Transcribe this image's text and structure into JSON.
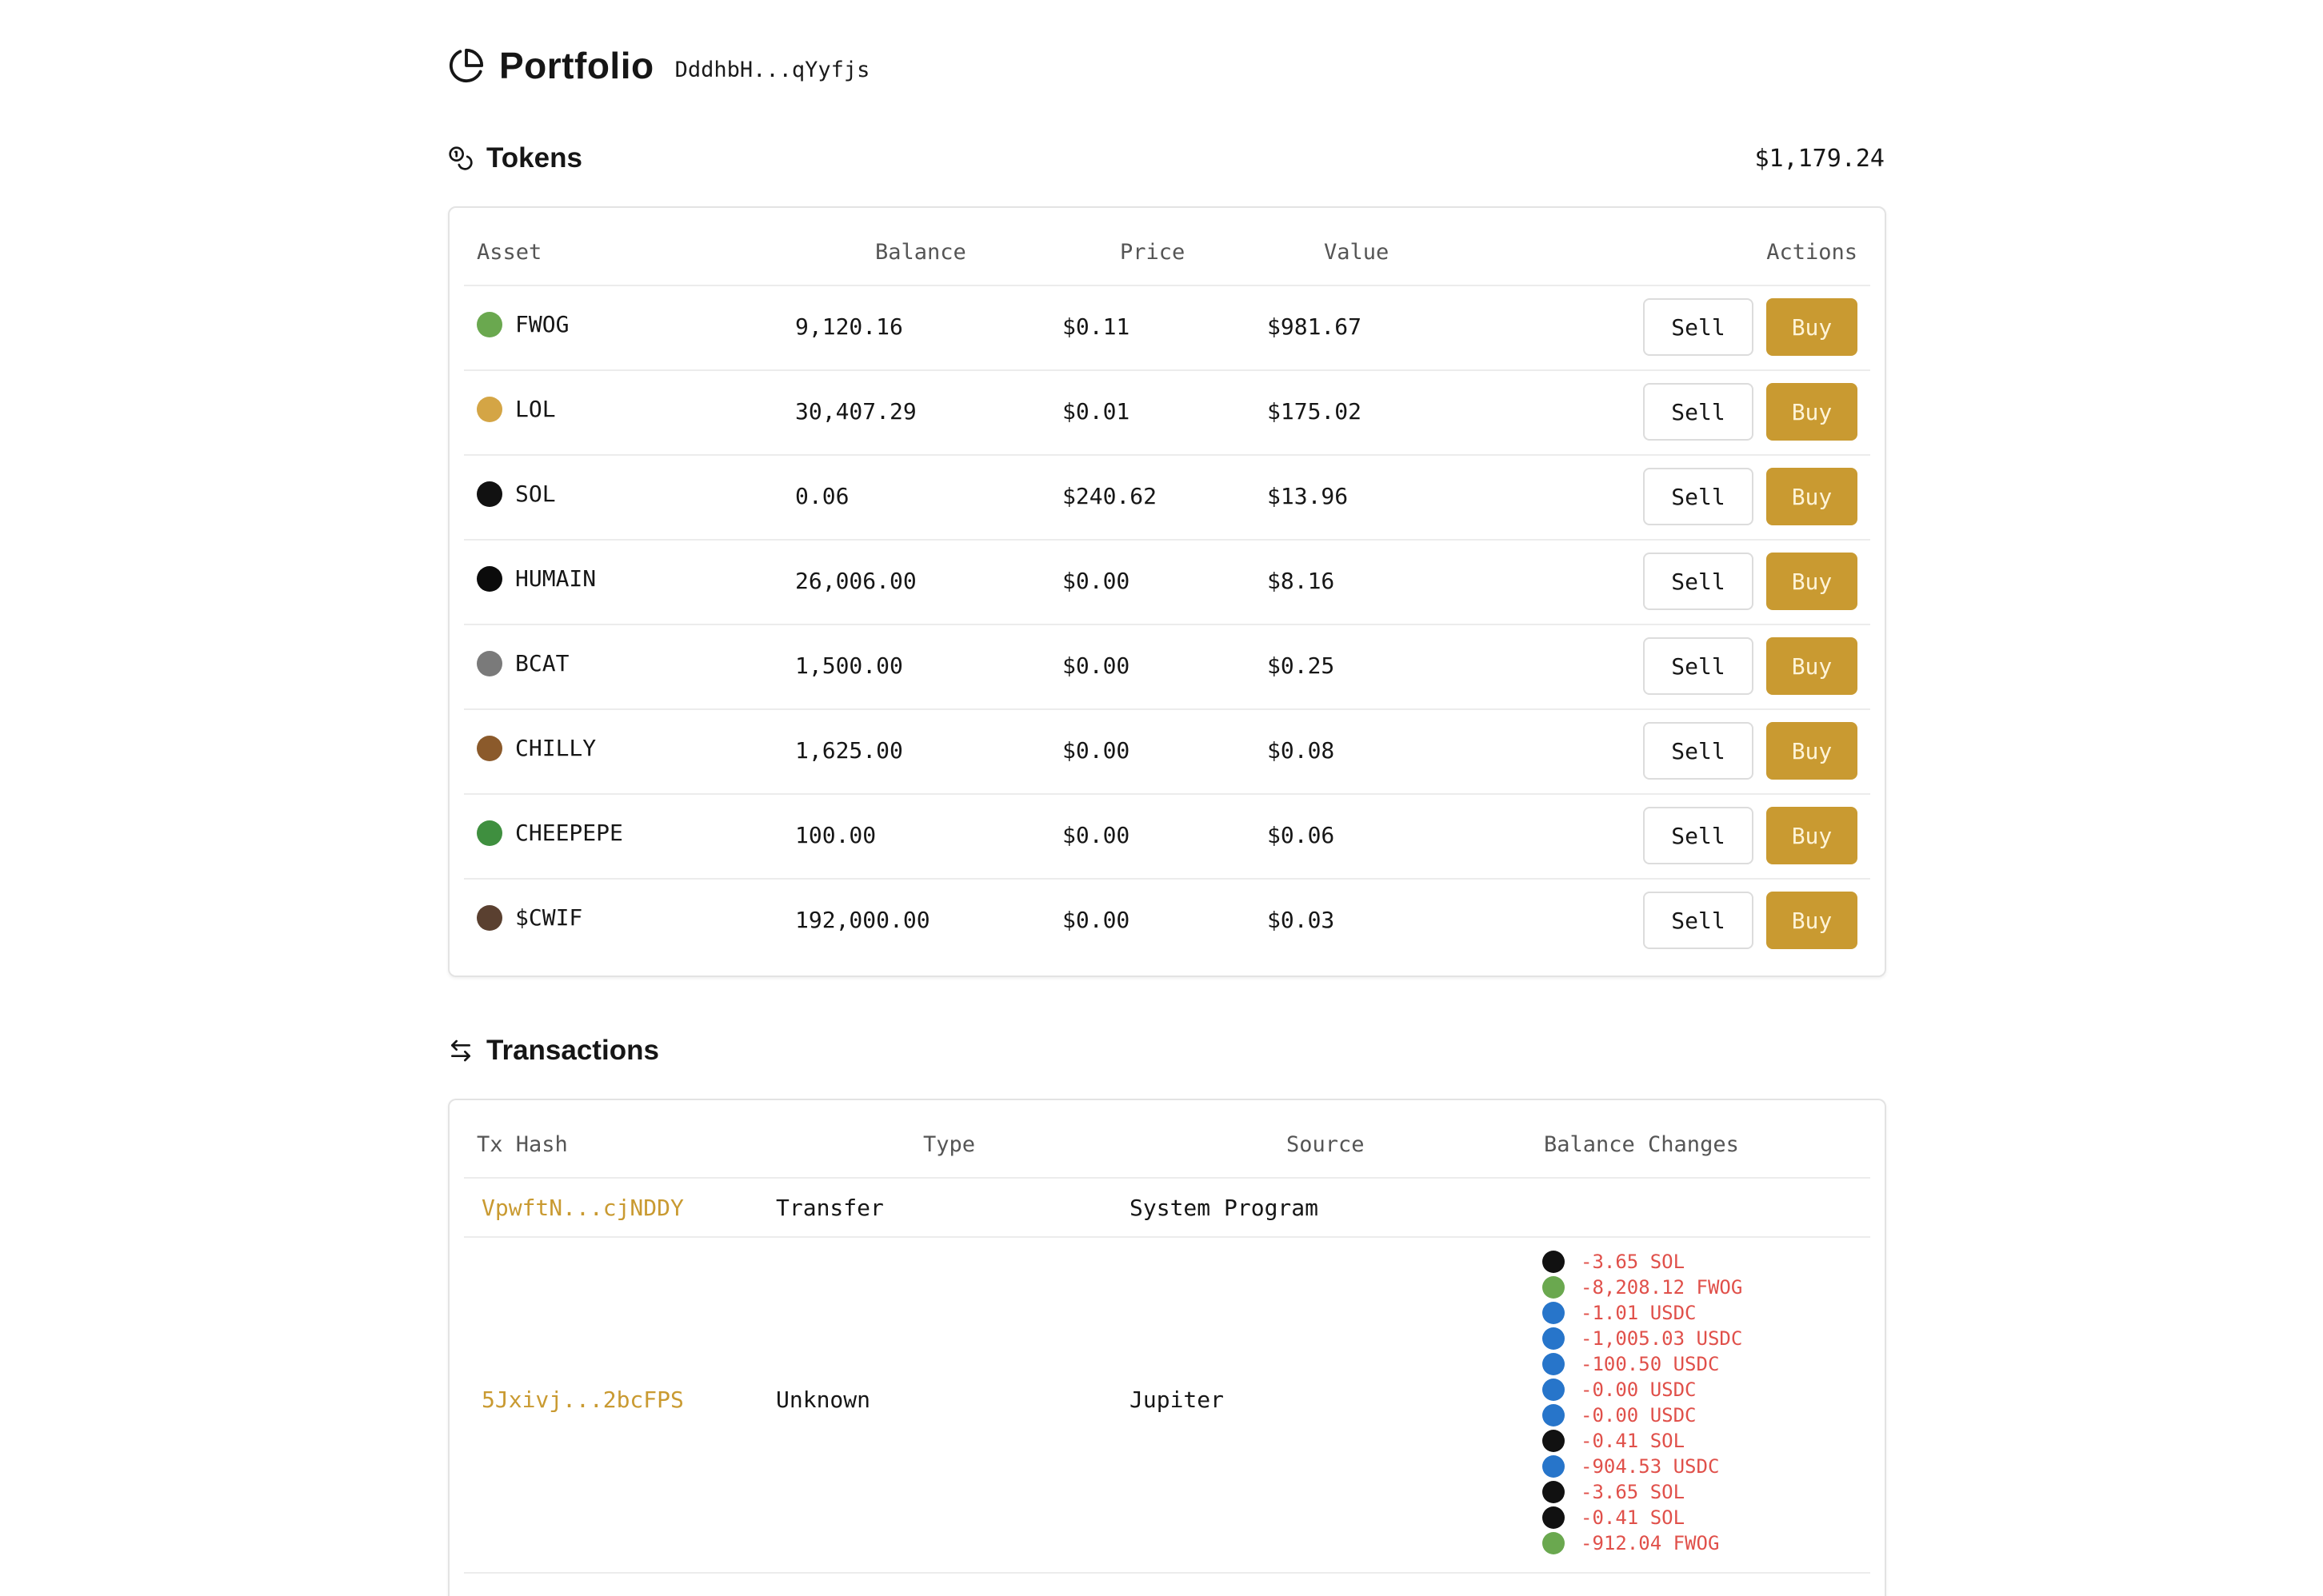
{
  "header": {
    "title": "Portfolio",
    "address": "DddhbH...qYyfjs"
  },
  "tokens": {
    "title": "Tokens",
    "total": "$1,179.24",
    "columns": {
      "asset": "Asset",
      "balance": "Balance",
      "price": "Price",
      "value": "Value",
      "actions": "Actions"
    },
    "sell_label": "Sell",
    "buy_label": "Buy",
    "rows": [
      {
        "symbol": "FWOG",
        "balance": "9,120.16",
        "price": "$0.11",
        "value": "$981.67",
        "logo_color": "#6aa84f",
        "icon": "frog-token-icon"
      },
      {
        "symbol": "LOL",
        "balance": "30,407.29",
        "price": "$0.01",
        "value": "$175.02",
        "logo_color": "#d4a545",
        "icon": "lol-token-icon"
      },
      {
        "symbol": "SOL",
        "balance": "0.06",
        "price": "$240.62",
        "value": "$13.96",
        "logo_color": "#111111",
        "icon": "solana-token-icon"
      },
      {
        "symbol": "HUMAIN",
        "balance": "26,006.00",
        "price": "$0.00",
        "value": "$8.16",
        "logo_color": "#0b0b0b",
        "icon": "humain-token-icon"
      },
      {
        "symbol": "BCAT",
        "balance": "1,500.00",
        "price": "$0.00",
        "value": "$0.25",
        "logo_color": "#7a7a7a",
        "icon": "bcat-token-icon"
      },
      {
        "symbol": "CHILLY",
        "balance": "1,625.00",
        "price": "$0.00",
        "value": "$0.08",
        "logo_color": "#8b5a2b",
        "icon": "chilly-token-icon"
      },
      {
        "symbol": "CHEEPEPE",
        "balance": "100.00",
        "price": "$0.00",
        "value": "$0.06",
        "logo_color": "#3f8f3f",
        "icon": "cheepepe-token-icon"
      },
      {
        "symbol": "$CWIF",
        "balance": "192,000.00",
        "price": "$0.00",
        "value": "$0.03",
        "logo_color": "#5a4030",
        "icon": "cwif-token-icon"
      }
    ]
  },
  "transactions": {
    "title": "Transactions",
    "columns": {
      "hash": "Tx Hash",
      "type": "Type",
      "source": "Source",
      "changes": "Balance Changes"
    },
    "rows": [
      {
        "hash": "VpwftN...cjNDDY",
        "type": "Transfer",
        "source": "System Program",
        "changes": []
      },
      {
        "hash": "5Jxivj...2bcFPS",
        "type": "Unknown",
        "source": "Jupiter",
        "changes": [
          {
            "text": "-3.65 SOL",
            "token": "sol"
          },
          {
            "text": "-8,208.12 FWOG",
            "token": "fwog"
          },
          {
            "text": "-1.01 USDC",
            "token": "usdc"
          },
          {
            "text": "-1,005.03 USDC",
            "token": "usdc"
          },
          {
            "text": "-100.50 USDC",
            "token": "usdc"
          },
          {
            "text": "-0.00 USDC",
            "token": "usdc"
          },
          {
            "text": "-0.00 USDC",
            "token": "usdc"
          },
          {
            "text": "-0.41 SOL",
            "token": "sol"
          },
          {
            "text": "-904.53 USDC",
            "token": "usdc"
          },
          {
            "text": "-3.65 SOL",
            "token": "sol"
          },
          {
            "text": "-0.41 SOL",
            "token": "sol"
          },
          {
            "text": "-912.04 FWOG",
            "token": "fwog"
          }
        ]
      }
    ]
  },
  "colors": {
    "accent": "#c99a31",
    "negative": "#e0504a",
    "usdc": "#2775ca",
    "sol": "#111111",
    "fwog": "#6aa84f"
  }
}
